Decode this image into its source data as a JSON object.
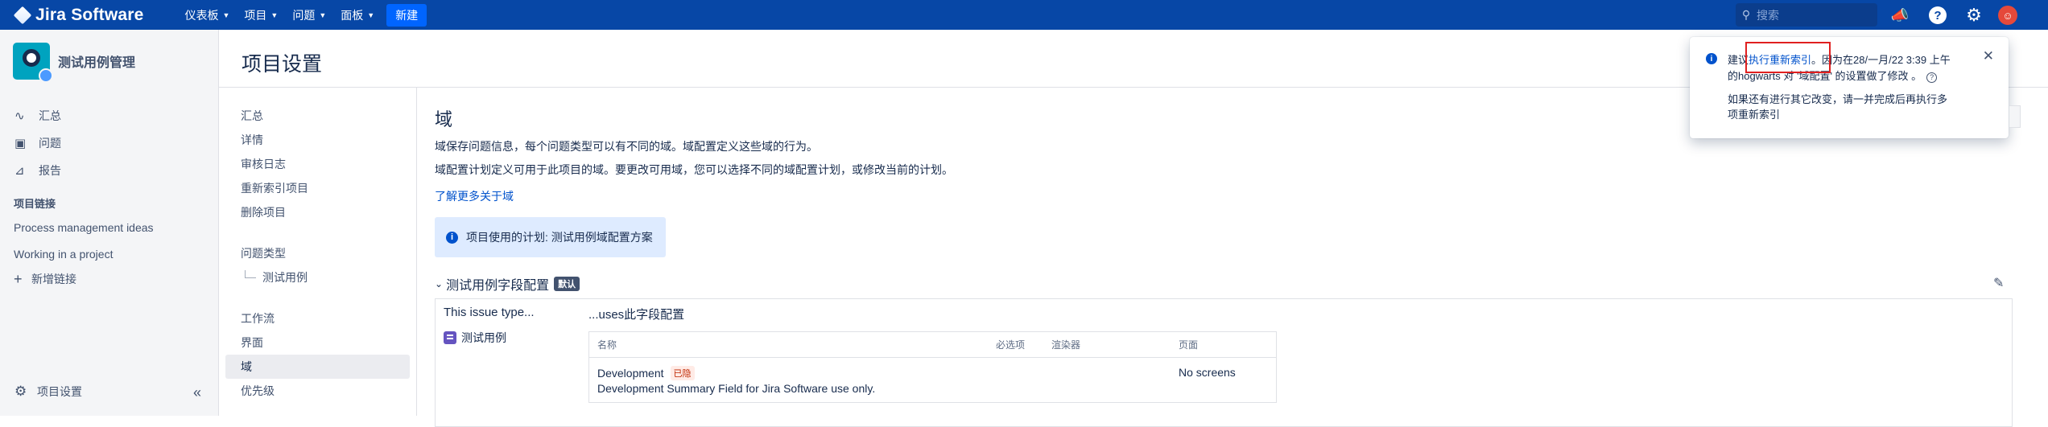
{
  "topnav": {
    "product": "Jira Software",
    "menu": [
      {
        "label": "仪表板"
      },
      {
        "label": "项目"
      },
      {
        "label": "问题"
      },
      {
        "label": "面板"
      }
    ],
    "create_label": "新建",
    "search_placeholder": "搜索"
  },
  "sidebar": {
    "project_name": "测试用例管理",
    "nav": [
      {
        "label": "汇总",
        "icon": "pulse-icon"
      },
      {
        "label": "问题",
        "icon": "issues-icon"
      },
      {
        "label": "报告",
        "icon": "chart-icon"
      }
    ],
    "links_heading": "项目链接",
    "links": [
      "Process management ideas",
      "Working in a project"
    ],
    "add_link": "新增链接",
    "footer": "项目设置"
  },
  "page": {
    "title": "项目设置"
  },
  "settings_nav": {
    "group1": [
      "汇总",
      "详情",
      "审核日志",
      "重新索引项目",
      "删除项目"
    ],
    "issue_types_label": "问题类型",
    "issue_types_sub": "测试用例",
    "group3": [
      "工作流",
      "界面",
      "域",
      "优先级"
    ],
    "active": "域"
  },
  "main": {
    "section_title": "域",
    "desc1": "域保存问题信息，每个问题类型可以有不同的域。域配置定义这些域的行为。",
    "desc2": "域配置计划定义可用于此项目的域。要更改可用域，您可以选择不同的域配置计划，或修改当前的计划。",
    "learn_more": "了解更多关于域",
    "scheme_info": "项目使用的计划: 测试用例域配置方案",
    "config_name": "测试用例字段配置",
    "default_badge": "默认",
    "issue_type_col": "This issue type...",
    "uses_col": "...uses此字段配置",
    "issue_type": "测试用例",
    "table_headers": {
      "name": "名称",
      "required": "必选项",
      "renderer": "渲染器",
      "screens": "页面"
    },
    "rows": [
      {
        "name": "Development",
        "hidden_badge": "已隐",
        "description": "Development Summary Field for Jira Software use only.",
        "screens": "No screens"
      }
    ]
  },
  "flag": {
    "line1_prefix": "建议",
    "line1_link": "执行重新索引",
    "line1_suffix": "。因为在28/一月/22 3:39 上午",
    "line2": "的hogwarts 对 '域配置' 的设置做了修改 。",
    "line3": "如果还有进行其它改变，请一并完成后再执行多",
    "line4": "项重新索引"
  },
  "colors": {
    "nav_bg": "#0747a6",
    "create_btn": "#0065ff",
    "link": "#0052cc",
    "info_bg": "#deebff",
    "highlight": "#e02020"
  }
}
